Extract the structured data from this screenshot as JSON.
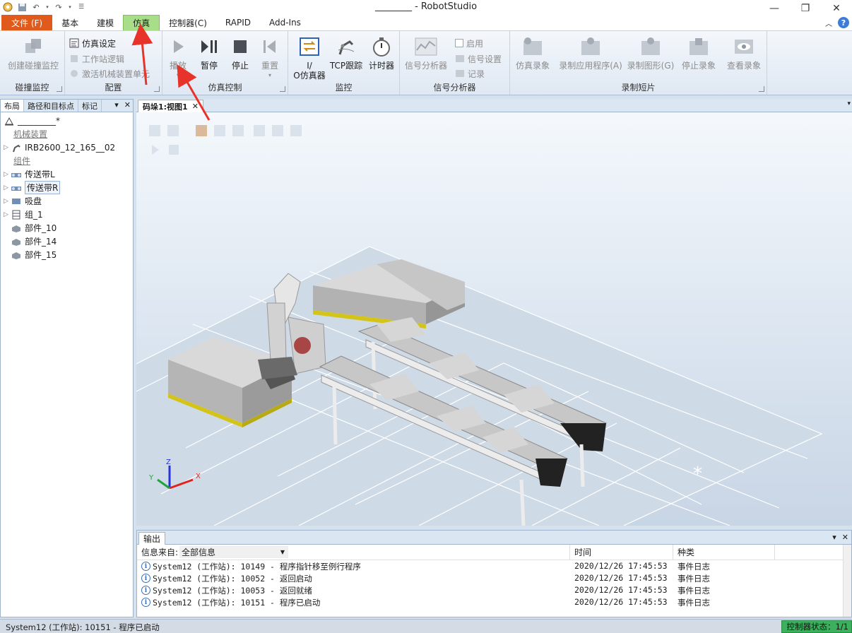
{
  "window": {
    "title": "________ - RobotStudio",
    "controls": [
      "minimize-icon",
      "restore-icon",
      "close-icon"
    ]
  },
  "menu": {
    "tabs": [
      "文件 (F)",
      "基本",
      "建模",
      "仿真",
      "控制器(C)",
      "RAPID",
      "Add-Ins"
    ],
    "active": "仿真"
  },
  "ribbon": {
    "collision": {
      "label": "碰撞监控",
      "create": "创建碰撞监控"
    },
    "config": {
      "label": "配置",
      "sim_settings": "仿真设定",
      "station_logic": "工作站逻辑",
      "activate_unit": "激活机械装置单元"
    },
    "sim_control": {
      "label": "仿真控制",
      "play": "播放",
      "pause": "暂停",
      "stop": "停止",
      "reset": "重置"
    },
    "monitor": {
      "label": "监控",
      "io_sim_1": "I/",
      "io_sim_2": "O仿真器",
      "tcp_trace": "TCP跟踪",
      "timer": "计时器"
    },
    "signal_analyzer": {
      "label": "信号分析器",
      "analyzer": "信号分析器",
      "enable": "启用",
      "signal_settings": "信号设置",
      "record": "记录"
    },
    "recording": {
      "label": "录制短片",
      "sim_record": "仿真录象",
      "record_app": "录制应用程序(A)",
      "record_graphics": "录制图形(G)",
      "stop_record": "停止录象",
      "view_record": "查看录象"
    }
  },
  "leftpanel": {
    "tabs": [
      "布局",
      "路径和目标点",
      "标记"
    ],
    "station": "_________*",
    "cat_mechanisms": "机械装置",
    "robot": "IRB2600_12_165__02",
    "cat_components": "组件",
    "items": [
      "传送带L",
      "传送带R",
      "吸盘",
      "组_1",
      "部件_10",
      "部件_14",
      "部件_15"
    ]
  },
  "viewport": {
    "tab": "码垛1:视图1"
  },
  "output": {
    "tab": "输出",
    "filter_label": "信息来自:",
    "filter_value": "全部信息",
    "col_time": "时间",
    "col_category": "种类",
    "rows": [
      {
        "msg": "System12 (工作站): 10149 - 程序指针移至例行程序",
        "time": "2020/12/26 17:45:53",
        "cat": "事件日志"
      },
      {
        "msg": "System12 (工作站): 10052 - 返回启动",
        "time": "2020/12/26 17:45:53",
        "cat": "事件日志"
      },
      {
        "msg": "System12 (工作站): 10053 - 返回就绪",
        "time": "2020/12/26 17:45:53",
        "cat": "事件日志"
      },
      {
        "msg": "System12 (工作站): 10151 - 程序已启动",
        "time": "2020/12/26 17:45:53",
        "cat": "事件日志"
      }
    ]
  },
  "statusbar": {
    "text": "System12 (工作站): 10151 - 程序已启动",
    "controller_status": "控制器状态：",
    "controller_count": "1/1"
  },
  "colors": {
    "file_tab": "#e05a1c",
    "active_tab": "#a8dd8a",
    "annotation_arrow": "#e8332a",
    "status_green": "#3bb15d"
  }
}
